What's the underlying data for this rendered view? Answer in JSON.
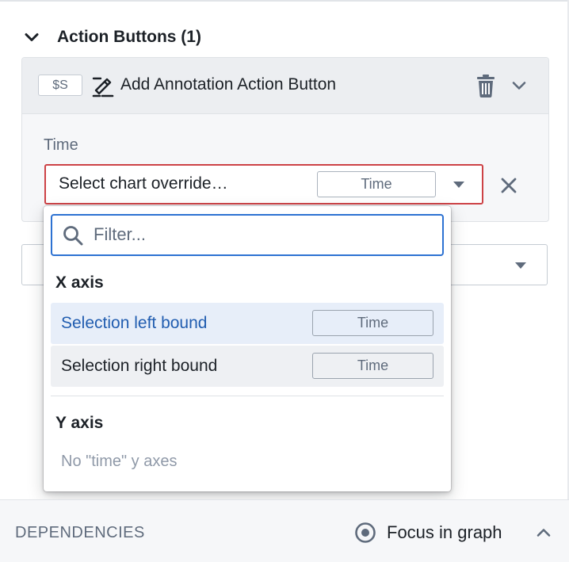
{
  "section": {
    "title": "Action Buttons (1)"
  },
  "action_card": {
    "variable_chip": "$S",
    "title": "Add Annotation Action Button",
    "icons": {
      "annotation": "annotation-pen-icon",
      "delete": "trash-icon",
      "expand": "chevron-down-icon"
    },
    "time_field": {
      "label": "Time",
      "placeholder": "Select chart override…",
      "type_tag": "Time"
    }
  },
  "dropdown": {
    "filter_placeholder": "Filter...",
    "groups": [
      {
        "title": "X axis",
        "items": [
          {
            "label": "Selection left bound",
            "type_tag": "Time",
            "state": "active"
          },
          {
            "label": "Selection right bound",
            "type_tag": "Time",
            "state": "hover"
          }
        ]
      },
      {
        "title": "Y axis",
        "empty_text": "No \"time\" y axes"
      }
    ]
  },
  "footer": {
    "title": "DEPENDENCIES",
    "focus_label": "Focus in graph"
  },
  "colors": {
    "accent": "#2d72d2",
    "error": "#cd4246",
    "active_text": "#215db0",
    "active_bg": "#e7eef9"
  }
}
